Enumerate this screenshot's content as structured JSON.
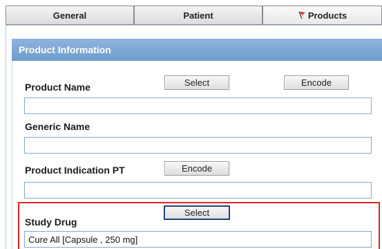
{
  "tabs": [
    {
      "label": "General"
    },
    {
      "label": "Patient"
    },
    {
      "label": "Products",
      "icon": "red-flag-icon",
      "active": true
    }
  ],
  "section": {
    "title": "Product Information"
  },
  "fields": {
    "product_name": {
      "label": "Product Name",
      "value": ""
    },
    "generic_name": {
      "label": "Generic Name",
      "value": ""
    },
    "product_indication_pt": {
      "label": "Product Indication PT",
      "value": ""
    },
    "study_drug": {
      "label": "Study Drug",
      "value": "Cure All [Capsule , 250 mg]"
    }
  },
  "buttons": {
    "select": "Select",
    "encode": "Encode"
  },
  "colors": {
    "section_header": "#7fa6d5",
    "field_border": "#7fa7d3",
    "highlight_border": "#e02020",
    "flag": "#d92020"
  }
}
